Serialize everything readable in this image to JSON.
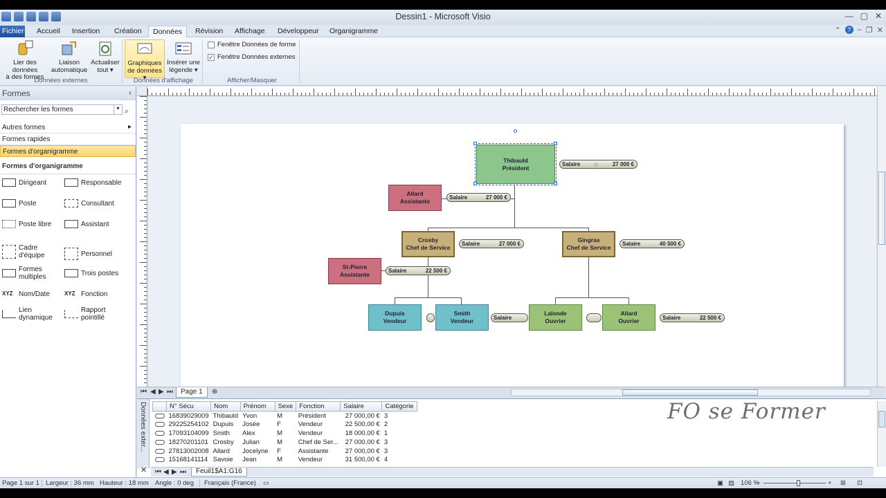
{
  "window": {
    "title": "Dessin1 - Microsoft Visio"
  },
  "ribbon_tabs": [
    "Fichier",
    "Accueil",
    "Insertion",
    "Création",
    "Données",
    "Révision",
    "Affichage",
    "Développeur",
    "Organigramme"
  ],
  "active_tab": "Données",
  "ribbon": {
    "lier": "Lier des données\nà des formes",
    "liaison": "Liaison\nautomatique",
    "actualiser": "Actualiser\ntout ▾",
    "graphiques": "Graphiques\nde données ▾",
    "legende": "Insérer une\nlégende ▾",
    "group_ext": "Données externes",
    "group_aff": "Données d'affichage",
    "group_show": "Afficher/Masquer",
    "chk_forme": "Fenêtre Données de forme",
    "chk_ext": "Fenêtre Données externes",
    "chk_forme_checked": false,
    "chk_ext_checked": true
  },
  "shapes_pane": {
    "title": "Formes",
    "search_placeholder": "Rechercher les formes",
    "autres": "Autres formes",
    "rapides": "Formes rapides",
    "orga_selected": "Formes d'organigramme",
    "stencil_title": "Formes d'organigramme",
    "items": [
      {
        "label": "Dirigeant"
      },
      {
        "label": "Responsable"
      },
      {
        "label": "Poste"
      },
      {
        "label": "Consultant"
      },
      {
        "label": "Poste libre"
      },
      {
        "label": "Assistant"
      },
      {
        "label": "Cadre\nd'équipe"
      },
      {
        "label": "Personnel"
      },
      {
        "label": "Formes\nmultiples"
      },
      {
        "label": "Trois postes"
      },
      {
        "label": "Nom/Date"
      },
      {
        "label": "Fonction"
      },
      {
        "label": "Lien\ndynamique"
      },
      {
        "label": "Rapport\npointillé"
      }
    ]
  },
  "org": {
    "thibauld": "Thibauld\nPrésident",
    "allard": "Allard\nAssistante",
    "crosby": "Crosby\nChef de Service",
    "gingras": "Gingras\nChef de Service",
    "stpierre": "St-Pierre\nAssistante",
    "dupuis": "Dupuis\nVendeur",
    "smith": "Smith\nVendeur",
    "lalonde": "Lalonde\nOuvrier",
    "allard2": "Allard\nOuvrier",
    "pill_label": "Salaire",
    "pills": [
      "27 000 €",
      "27 000 €",
      "27 000 €",
      "40 500 €",
      "22 500 €",
      "22 500 €"
    ]
  },
  "page_tab": "Page 1",
  "ext_window_label": "Données exter...",
  "table": {
    "headers": [
      "N° Sécu",
      "Nom",
      "Prénom",
      "Sexe",
      "Fonction",
      "Salaire",
      "Catégorie"
    ],
    "rows": [
      [
        "16839029009",
        "Thibauld",
        "Yvon",
        "M",
        "Président",
        "27 000,00 €",
        "3"
      ],
      [
        "29225254102",
        "Dupuis",
        "Josée",
        "F",
        "Vendeur",
        "22 500,00 €",
        "2"
      ],
      [
        "17093104099",
        "Smith",
        "Alex",
        "M",
        "Vendeur",
        "18 000,00 €",
        "1"
      ],
      [
        "18270201101",
        "Crosby",
        "Julian",
        "M",
        "Chef de Ser...",
        "27 000,00 €",
        "3"
      ],
      [
        "27813002008",
        "Allard",
        "Jocelyne",
        "F",
        "Assistante",
        "27 000,00 €",
        "3"
      ],
      [
        "15168141114",
        "Savoie",
        "Jean",
        "M",
        "Vendeur",
        "31 500,00 €",
        "4"
      ]
    ],
    "sheet_tab": "Feuil1$A1:G16"
  },
  "watermark": "FO se Former",
  "status": {
    "page": "Page 1 sur 1",
    "largeur": "Largeur : 36 mm",
    "hauteur": "Hauteur : 18 mm",
    "angle": "Angle : 0 deg",
    "langue": "Français (France)",
    "zoom": "106 %"
  }
}
